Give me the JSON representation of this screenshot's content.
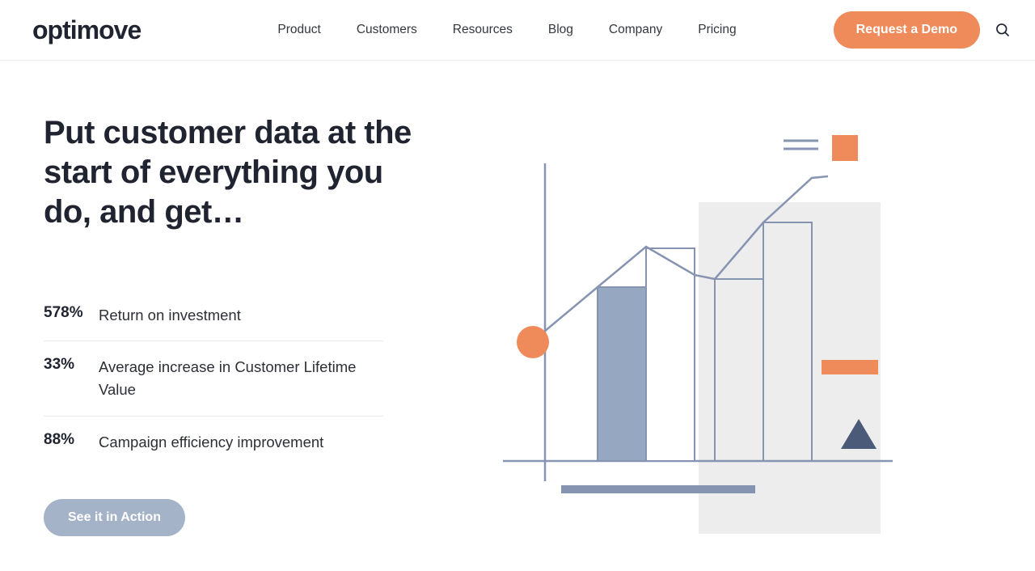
{
  "brand": "optimove",
  "nav": {
    "items": [
      "Product",
      "Customers",
      "Resources",
      "Blog",
      "Company",
      "Pricing"
    ]
  },
  "cta_primary": "Request a Demo",
  "hero": {
    "headline": "Put customer data at the start of everything you do, and get…",
    "stats": [
      {
        "value": "578%",
        "label": "Return on investment"
      },
      {
        "value": "33%",
        "label": "Average increase in Customer Lifetime Value"
      },
      {
        "value": "88%",
        "label": "Campaign efficiency improvement"
      }
    ],
    "cta_secondary": "See it in Action"
  },
  "colors": {
    "orange": "#ef8a5a",
    "slate": "#a5b3c8",
    "slate_fill": "#96a7c2",
    "axis": "#8694b2",
    "gray_bg": "#ededed",
    "dark_triangle": "#4a5a78"
  }
}
